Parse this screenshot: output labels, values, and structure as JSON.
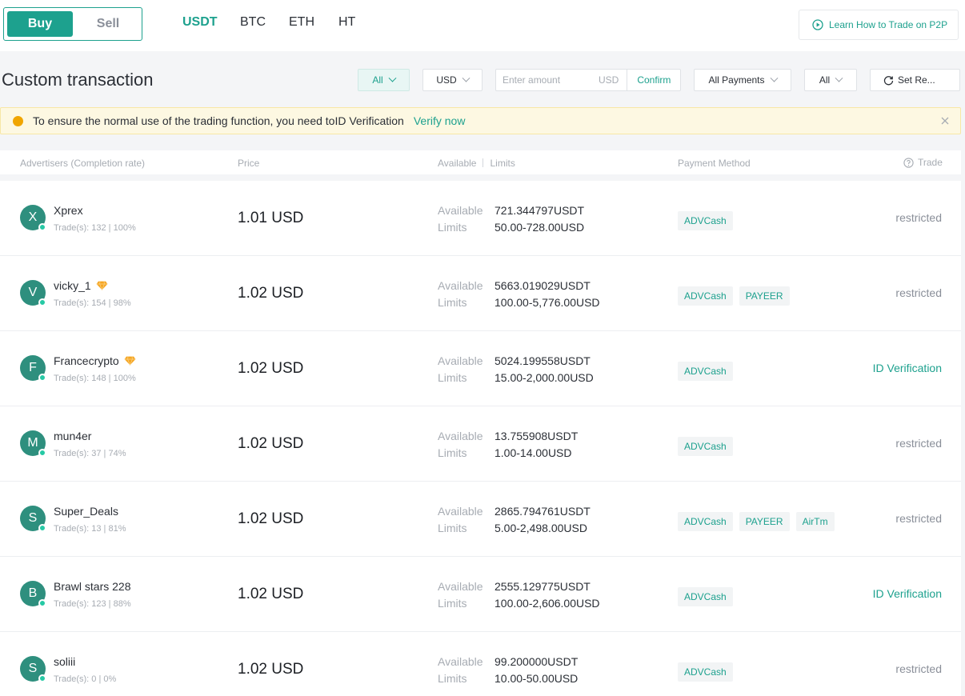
{
  "header": {
    "buy_label": "Buy",
    "sell_label": "Sell",
    "coins": [
      "USDT",
      "BTC",
      "ETH",
      "HT"
    ],
    "active_coin": "USDT",
    "learn_label": "Learn How to Trade on P2P"
  },
  "filters": {
    "title": "Custom transaction",
    "type_value": "All",
    "currency_value": "USD",
    "amount_placeholder": "Enter amount",
    "amount_unit": "USD",
    "confirm_label": "Confirm",
    "payments_value": "All Payments",
    "region_value": "All",
    "reset_label": "Set Re..."
  },
  "notice": {
    "text": "To ensure the normal use of the trading function, you need toID Verification",
    "action": "Verify now"
  },
  "table": {
    "col_advertisers": "Advertisers (Completion rate)",
    "col_price": "Price",
    "col_available": "Available",
    "col_limits": "Limits",
    "col_payment": "Payment Method",
    "col_trade": "Trade",
    "available_label": "Available",
    "limits_label": "Limits"
  },
  "rows": [
    {
      "initial": "X",
      "name": "Xprex",
      "badge": false,
      "trades": "Trade(s): 132 | 100%",
      "price": "1.01 USD",
      "available": "721.344797USDT",
      "limits": "50.00-728.00USD",
      "payments": [
        "ADVCash"
      ],
      "trade": "restricted",
      "trade_link": false
    },
    {
      "initial": "V",
      "name": "vicky_1",
      "badge": true,
      "trades": "Trade(s): 154 | 98%",
      "price": "1.02 USD",
      "available": "5663.019029USDT",
      "limits": "100.00-5,776.00USD",
      "payments": [
        "ADVCash",
        "PAYEER"
      ],
      "trade": "restricted",
      "trade_link": false
    },
    {
      "initial": "F",
      "name": "Francecrypto",
      "badge": true,
      "trades": "Trade(s): 148 | 100%",
      "price": "1.02 USD",
      "available": "5024.199558USDT",
      "limits": "15.00-2,000.00USD",
      "payments": [
        "ADVCash"
      ],
      "trade": "ID Verification",
      "trade_link": true
    },
    {
      "initial": "M",
      "name": "mun4er",
      "badge": false,
      "trades": "Trade(s): 37 | 74%",
      "price": "1.02 USD",
      "available": "13.755908USDT",
      "limits": "1.00-14.00USD",
      "payments": [
        "ADVCash"
      ],
      "trade": "restricted",
      "trade_link": false
    },
    {
      "initial": "S",
      "name": "Super_Deals",
      "badge": false,
      "trades": "Trade(s): 13 | 81%",
      "price": "1.02 USD",
      "available": "2865.794761USDT",
      "limits": "5.00-2,498.00USD",
      "payments": [
        "ADVCash",
        "PAYEER",
        "AirTm"
      ],
      "trade": "restricted",
      "trade_link": false
    },
    {
      "initial": "B",
      "name": "Brawl stars 228",
      "badge": false,
      "trades": "Trade(s): 123 | 88%",
      "price": "1.02 USD",
      "available": "2555.129775USDT",
      "limits": "100.00-2,606.00USD",
      "payments": [
        "ADVCash"
      ],
      "trade": "ID Verification",
      "trade_link": true
    },
    {
      "initial": "S",
      "name": "soliii",
      "badge": false,
      "trades": "Trade(s): 0 | 0%",
      "price": "1.02 USD",
      "available": "99.200000USDT",
      "limits": "10.00-50.00USD",
      "payments": [
        "ADVCash"
      ],
      "trade": "restricted",
      "trade_link": false
    }
  ],
  "colors": {
    "accent": "#1da18e",
    "avatar": "#2e8f7e",
    "online": "#26c9a5",
    "notice_bg": "#fdf8e2",
    "warning_dot": "#f0a500",
    "badge": "#f5a623"
  },
  "icons": {
    "learn": "play-circle-icon",
    "reset": "refresh-icon",
    "notice": "warning-dot-icon",
    "close": "close-icon",
    "help": "question-circle-icon",
    "badge": "diamond-icon"
  }
}
